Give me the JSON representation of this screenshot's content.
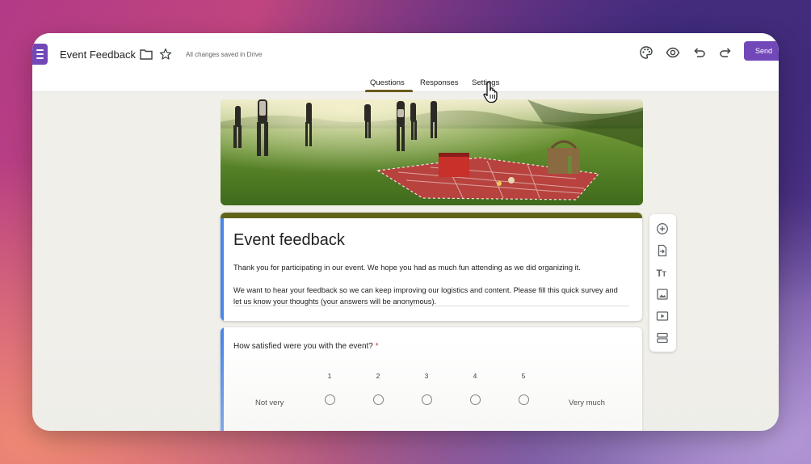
{
  "app": {
    "doc_title": "Event Feedback",
    "save_status": "All changes saved in Drive",
    "send_label": "Send",
    "icons": {
      "app": "forms-app-icon",
      "folder": "folder-icon",
      "star": "star-icon",
      "palette": "palette-icon",
      "preview": "eye-icon",
      "undo": "undo-icon",
      "redo": "redo-icon"
    }
  },
  "tabs": [
    {
      "label": "Questions",
      "active": true
    },
    {
      "label": "Responses",
      "active": false
    },
    {
      "label": "Settings",
      "active": false
    }
  ],
  "form": {
    "title": "Event feedback",
    "description_1": "Thank you for participating in our event. We hope you had as much fun attending as we did organizing it.",
    "description_2": "We want to hear your feedback so we can keep improving our logistics and content. Please fill this quick survey and let us know your thoughts (your answers will be anonymous).",
    "accent_color": "#5f6419",
    "card_accent_color": "#4a86e8"
  },
  "question": {
    "text": "How satisfied were you with the event?",
    "required_mark": "*",
    "scale": [
      "1",
      "2",
      "3",
      "4",
      "5"
    ],
    "low_label": "Not very",
    "high_label": "Very much"
  },
  "side_toolbar": [
    "add-question-icon",
    "import-questions-icon",
    "add-title-icon",
    "add-image-icon",
    "add-video-icon",
    "add-section-icon"
  ],
  "colors": {
    "brand": "#7248b9",
    "tab_underline": "#6b5a1e"
  }
}
